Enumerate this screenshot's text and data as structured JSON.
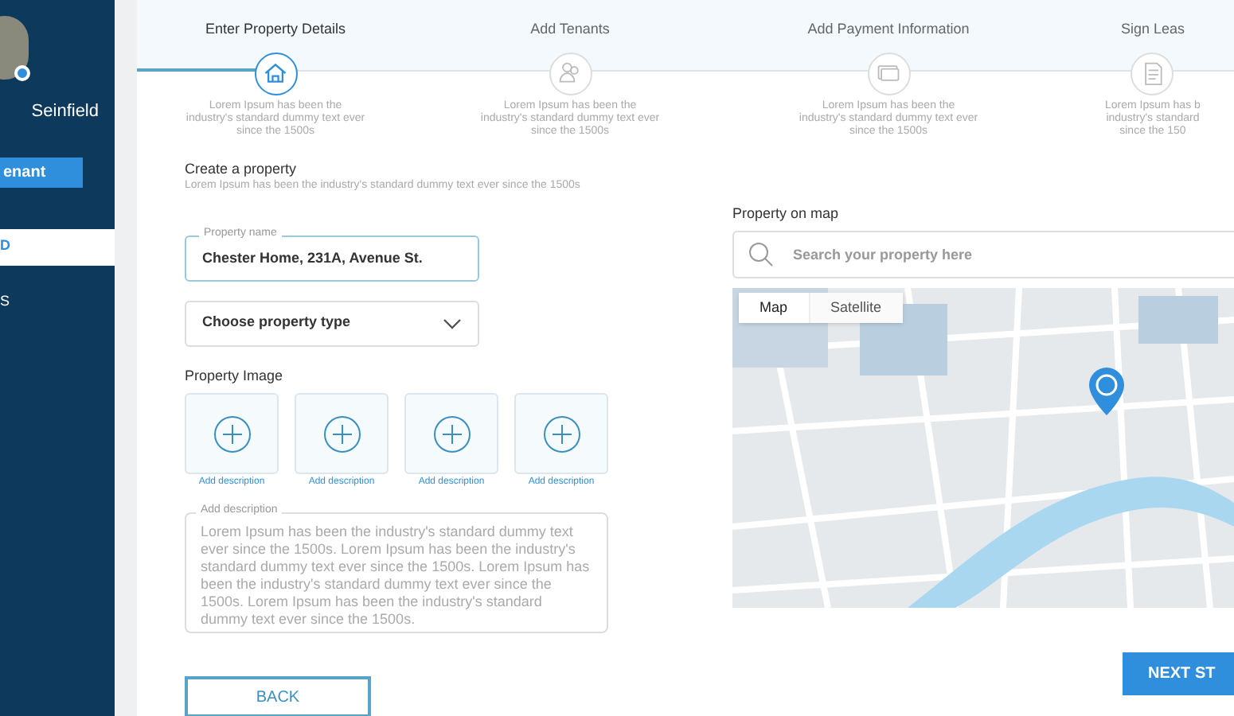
{
  "sidebar": {
    "user_name": "Seinfield",
    "button": "enant",
    "items": [
      {
        "label": "D",
        "selected": true
      },
      {
        "label": "S",
        "selected": false
      }
    ]
  },
  "steps": [
    {
      "title": "Enter Property Details",
      "selected": true,
      "desc_lines": [
        "Lorem Ipsum has been the",
        "industry's standard dummy text ever",
        "since the 1500s"
      ]
    },
    {
      "title": "Add Tenants",
      "selected": false,
      "desc_lines": [
        "Lorem Ipsum has been the",
        "industry's standard dummy text ever",
        "since the 1500s"
      ]
    },
    {
      "title": "Add Payment Information",
      "selected": false,
      "desc_lines": [
        "Lorem Ipsum has been the",
        "industry's standard dummy text ever",
        "since the 1500s"
      ]
    },
    {
      "title": "Sign Leas",
      "selected": false,
      "desc_lines": [
        "Lorem Ipsum has b",
        "industry's standard",
        "since the 150"
      ]
    }
  ],
  "form": {
    "heading": "Create a property",
    "subheading": "Lorem Ipsum has been the industry's standard dummy text ever since the 1500s",
    "property_name": {
      "label": "Property name",
      "value": "Chester Home, 231A, Avenue St."
    },
    "property_type": {
      "placeholder": "Choose property type"
    },
    "image_label": "Property Image",
    "image_slots": [
      {
        "link": "Add description"
      },
      {
        "link": "Add description"
      },
      {
        "link": "Add description"
      },
      {
        "link": "Add description"
      }
    ],
    "description": {
      "label": "Add description",
      "value": "Lorem Ipsum has been the industry's standard dummy text ever since the 1500s. Lorem Ipsum has been the industry's standard dummy text ever since the 1500s. Lorem Ipsum has been the industry's standard dummy text ever since the 1500s. Lorem Ipsum has been the industry's standard dummy text ever since the 1500s."
    }
  },
  "map": {
    "label": "Property on map",
    "search": {
      "placeholder": "Search your property here"
    },
    "view_tabs": [
      {
        "label": "Map",
        "selected": true
      },
      {
        "label": "Satellite",
        "selected": false
      }
    ]
  },
  "buttons": {
    "back": "BACK",
    "next": "NEXT ST"
  }
}
